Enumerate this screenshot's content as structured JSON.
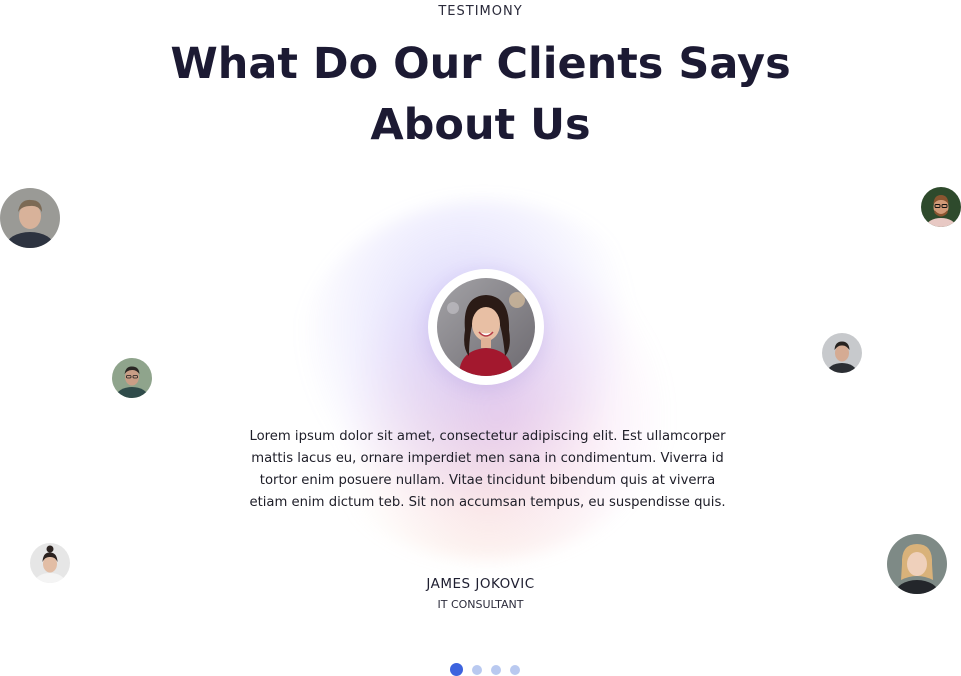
{
  "section": {
    "eyebrow": "TESTIMONY",
    "title_line1": "What Do Our Clients Says",
    "title_line2": "About Us"
  },
  "testimonial": {
    "quote": "Lorem ipsum dolor sit amet, consectetur adipiscing elit. Est ullamcorper mattis lacus eu, ornare imperdiet men sana in condimentum. Viverra id tortor enim posuere nullam. Vitae tincidunt bibendum quis at viverra etiam enim dictum teb. Sit non accumsan tempus, eu suspendisse quis.",
    "name": "JAMES JOKOVIC",
    "role": "IT CONSULTANT"
  },
  "slider": {
    "total_slides": 4,
    "active_slide": 1
  },
  "colors": {
    "heading": "#1c1a33",
    "dot_active": "#3d63de",
    "dot_inactive": "#b9c9f0"
  }
}
